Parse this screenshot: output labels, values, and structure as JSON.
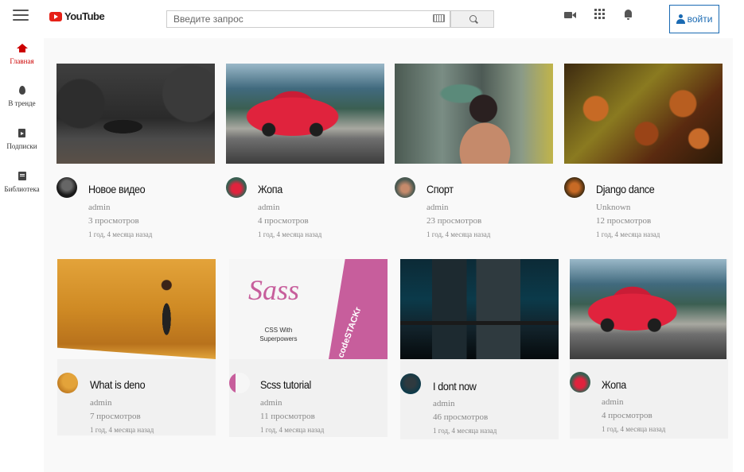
{
  "header": {
    "logo_text": "YouTube",
    "search_placeholder": "Введите запрос",
    "login_label": "войти"
  },
  "sidebar": {
    "items": [
      {
        "label": "Главная",
        "icon": "home-icon",
        "active": true
      },
      {
        "label": "В тренде",
        "icon": "fire-icon"
      },
      {
        "label": "Подписки",
        "icon": "subscriptions-icon"
      },
      {
        "label": "Библиотека",
        "icon": "library-icon"
      }
    ]
  },
  "videos": [
    {
      "title": "Новое видео",
      "channel": "admin",
      "views": "3 просмотров",
      "time": "1 год, 4 месяца назад"
    },
    {
      "title": "Жопа",
      "channel": "admin",
      "views": "4 просмотров",
      "time": "1 год, 4 месяца назад"
    },
    {
      "title": "Спорт",
      "channel": "admin",
      "views": "23 просмотров",
      "time": "1 год, 4 месяца назад"
    },
    {
      "title": "Django dance",
      "channel": "Unknown",
      "views": "12 просмотров",
      "time": "1 год, 4 месяца назад"
    },
    {
      "title": "What is deno",
      "channel": "admin",
      "views": "7 просмотров",
      "time": "1 год, 4 месяца назад"
    },
    {
      "title": "Scss tutorial",
      "channel": "admin",
      "views": "11 просмотров",
      "time": "1 год, 4 месяца назад"
    },
    {
      "title": "I dont now",
      "channel": "admin",
      "views": "46 просмотров",
      "time": "1 год, 4 месяца назад"
    },
    {
      "title": "Жопа",
      "channel": "admin",
      "views": "4 просмотров",
      "time": "1 год, 4 месяца назад"
    }
  ],
  "thumbnail_text": {
    "sass_logo": "Sass",
    "sass_tagline": "CSS With Superpowers",
    "codestack": "codeSTACKr"
  },
  "colors": {
    "brand_red": "#e62117",
    "active_red": "#cc0000",
    "login_blue": "#1a6ab3"
  }
}
